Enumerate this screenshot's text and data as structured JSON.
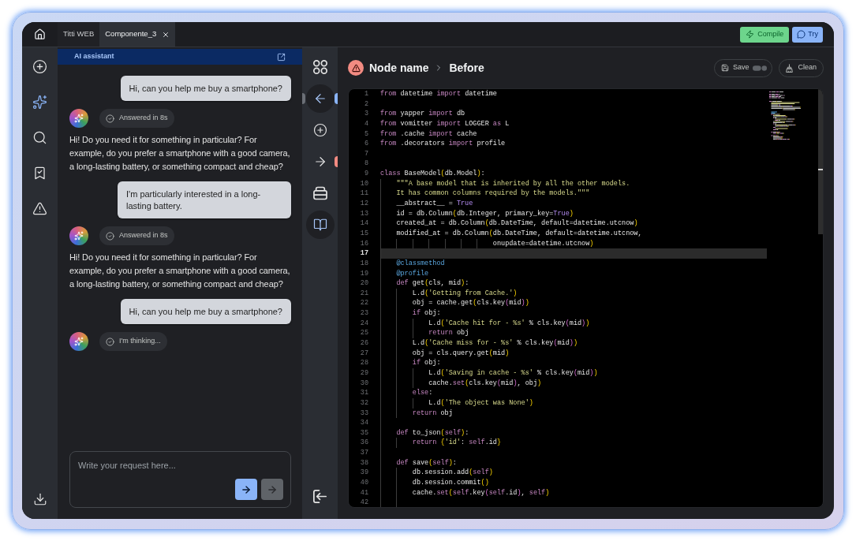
{
  "top_bar": {
    "tabs": [
      {
        "label": "Titti WEB",
        "selected": false,
        "closable": false
      },
      {
        "label": "Componente_3",
        "selected": true,
        "closable": true
      }
    ],
    "actions": [
      {
        "kind": "compile",
        "label": "Compile"
      },
      {
        "kind": "try",
        "label": "Try"
      }
    ]
  },
  "sidebar": {
    "items": [
      {
        "selected": false
      },
      {
        "selected": true
      },
      {
        "selected": false
      },
      {
        "selected": false
      },
      {
        "selected": false
      }
    ],
    "bottom_items": [
      {
        "selected": false
      }
    ]
  },
  "assistant": {
    "title": "AI assistant",
    "messages": [
      {
        "kind": "user",
        "text": "Hi, can you help me buy a smartphone?"
      },
      {
        "kind": "assistant",
        "status": "Answered in 8s",
        "text": "Hi! Do you need it for something in particular? For example, do you prefer a smartphone with a good camera, a long-lasting battery, or something compact and cheap?"
      },
      {
        "kind": "user",
        "text": "I'm particularly interested in a long-lasting battery."
      },
      {
        "kind": "assistant",
        "status": "Answered in 8s",
        "text": "Hi! Do you need it for something in particular? For example, do you prefer a smartphone with a good camera, a long-lasting battery, or something compact and cheap?"
      },
      {
        "kind": "user",
        "text": "Hi, can you help me buy a smartphone?"
      },
      {
        "kind": "assistant",
        "status": "I'm thinking..."
      }
    ],
    "input": {
      "placeholder": "Write your request here..."
    },
    "send_buttons": [
      {
        "disabled": false
      },
      {
        "disabled": true
      }
    ]
  },
  "toolbar": {
    "items": [
      {
        "selected": false
      },
      {
        "selected": true,
        "ports": [
          {
            "kind": "left",
            "color": "#6b6f76"
          },
          {
            "kind": "right",
            "color": "#8ab4f8"
          }
        ]
      },
      {
        "selected": false
      },
      {
        "selected": false,
        "ports": [
          {
            "kind": "right",
            "color": "#f28b82"
          }
        ]
      },
      {
        "selected": false
      },
      {
        "selected": true
      }
    ],
    "bottom_items": [
      {
        "selected": false
      }
    ]
  },
  "editor": {
    "error": true,
    "breadcrumb": [
      "Node name",
      "Before"
    ],
    "actions": [
      {
        "kind": "save",
        "label": "Save"
      },
      {
        "kind": "clean",
        "label": "Clean"
      }
    ],
    "lines": [
      {
        "number": "1",
        "highlighted": false,
        "tokens": [
          {
            "text": "from",
            "kind": "keyword"
          },
          {
            "text": " datetime ",
            "kind": "plain"
          },
          {
            "text": "import",
            "kind": "keyword"
          },
          {
            "text": " datetime",
            "kind": "plain"
          }
        ]
      },
      {
        "number": "2",
        "highlighted": false
      },
      {
        "number": "3",
        "highlighted": false,
        "tokens": [
          {
            "text": "from",
            "kind": "keyword"
          },
          {
            "text": " yapper ",
            "kind": "plain"
          },
          {
            "text": "import",
            "kind": "keyword"
          },
          {
            "text": " db",
            "kind": "plain"
          }
        ]
      },
      {
        "number": "4",
        "highlighted": false,
        "tokens": [
          {
            "text": "from",
            "kind": "keyword"
          },
          {
            "text": " vomitter ",
            "kind": "plain"
          },
          {
            "text": "import",
            "kind": "keyword"
          },
          {
            "text": " LOGGER ",
            "kind": "plain"
          },
          {
            "text": "as",
            "kind": "keyword"
          },
          {
            "text": " L",
            "kind": "plain"
          }
        ]
      },
      {
        "number": "5",
        "highlighted": false,
        "tokens": [
          {
            "text": "from",
            "kind": "keyword"
          },
          {
            "text": " .cache ",
            "kind": "plain"
          },
          {
            "text": "import",
            "kind": "keyword"
          },
          {
            "text": " cache",
            "kind": "plain"
          }
        ]
      },
      {
        "number": "6",
        "highlighted": false,
        "tokens": [
          {
            "text": "from",
            "kind": "keyword"
          },
          {
            "text": " .decorators ",
            "kind": "plain"
          },
          {
            "text": "import",
            "kind": "keyword"
          },
          {
            "text": " profile",
            "kind": "plain"
          }
        ]
      },
      {
        "number": "7",
        "highlighted": false
      },
      {
        "number": "8",
        "highlighted": false
      },
      {
        "number": "9",
        "highlighted": false,
        "tokens": [
          {
            "text": "class",
            "kind": "keyword"
          },
          {
            "text": " BaseModel",
            "kind": "plain"
          },
          {
            "text": "(",
            "kind": "bracket"
          },
          {
            "text": "db.Model",
            "kind": "plain"
          },
          {
            "text": ")",
            "kind": "bracket"
          },
          {
            "text": ":",
            "kind": "plain"
          }
        ]
      },
      {
        "number": "10",
        "highlighted": false,
        "tokens": [
          {
            "text": "    \"\"\"A base model that is inherited by all the other models.",
            "kind": "string"
          }
        ]
      },
      {
        "number": "11",
        "highlighted": false,
        "tokens": [
          {
            "text": "    It has common columns required by the models.\"\"\"",
            "kind": "string"
          }
        ]
      },
      {
        "number": "12",
        "highlighted": false,
        "tokens": [
          {
            "text": "    __abstract__ = ",
            "kind": "plain"
          },
          {
            "text": "True",
            "kind": "constant"
          }
        ]
      },
      {
        "number": "13",
        "highlighted": false,
        "tokens": [
          {
            "text": "    id = db.Column",
            "kind": "plain"
          },
          {
            "text": "(",
            "kind": "bracket"
          },
          {
            "text": "db.Integer, primary_key=",
            "kind": "plain"
          },
          {
            "text": "True",
            "kind": "constant"
          },
          {
            "text": ")",
            "kind": "bracket"
          }
        ]
      },
      {
        "number": "14",
        "highlighted": false,
        "tokens": [
          {
            "text": "    created_at = db.Column",
            "kind": "plain"
          },
          {
            "text": "(",
            "kind": "bracket"
          },
          {
            "text": "db.DateTime, default=datetime.utcnow",
            "kind": "plain"
          },
          {
            "text": ")",
            "kind": "bracket"
          }
        ]
      },
      {
        "number": "15",
        "highlighted": false,
        "tokens": [
          {
            "text": "    modified_at = db.Column",
            "kind": "plain"
          },
          {
            "text": "(",
            "kind": "bracket"
          },
          {
            "text": "db.DateTime, default=datetime.utcnow,",
            "kind": "plain"
          }
        ]
      },
      {
        "number": "16",
        "highlighted": false,
        "tokens": [
          {
            "text": "                            onupdate=datetime.utcnow",
            "kind": "plain"
          },
          {
            "text": ")",
            "kind": "bracket"
          }
        ]
      },
      {
        "number": "17",
        "highlighted": true
      },
      {
        "number": "18",
        "highlighted": false,
        "tokens": [
          {
            "text": "    @classmethod",
            "kind": "decorator"
          }
        ]
      },
      {
        "number": "19",
        "highlighted": false,
        "tokens": [
          {
            "text": "    @profile",
            "kind": "decorator"
          }
        ]
      },
      {
        "number": "20",
        "highlighted": false,
        "tokens": [
          {
            "text": "    def",
            "kind": "keyword"
          },
          {
            "text": " get",
            "kind": "plain"
          },
          {
            "text": "(",
            "kind": "bracket"
          },
          {
            "text": "cls, mid",
            "kind": "plain"
          },
          {
            "text": ")",
            "kind": "bracket"
          },
          {
            "text": ":",
            "kind": "plain"
          }
        ]
      },
      {
        "number": "21",
        "highlighted": false,
        "tokens": [
          {
            "text": "        L.d",
            "kind": "plain"
          },
          {
            "text": "(",
            "kind": "bracket"
          },
          {
            "text": "'Getting from Cache.'",
            "kind": "string"
          },
          {
            "text": ")",
            "kind": "bracket"
          }
        ]
      },
      {
        "number": "22",
        "highlighted": false,
        "tokens": [
          {
            "text": "        obj = cache.get",
            "kind": "plain"
          },
          {
            "text": "(",
            "kind": "bracket"
          },
          {
            "text": "cls.key",
            "kind": "plain"
          },
          {
            "text": "(",
            "kind": "bracket2"
          },
          {
            "text": "mid",
            "kind": "plain"
          },
          {
            "text": ")",
            "kind": "bracket2"
          },
          {
            "text": ")",
            "kind": "bracket"
          }
        ]
      },
      {
        "number": "23",
        "highlighted": false,
        "tokens": [
          {
            "text": "        if",
            "kind": "keyword"
          },
          {
            "text": " obj:",
            "kind": "plain"
          }
        ]
      },
      {
        "number": "24",
        "highlighted": false,
        "tokens": [
          {
            "text": "            L.d",
            "kind": "plain"
          },
          {
            "text": "(",
            "kind": "bracket"
          },
          {
            "text": "'Cache hit for - %s'",
            "kind": "string"
          },
          {
            "text": " % cls.key",
            "kind": "plain"
          },
          {
            "text": "(",
            "kind": "bracket2"
          },
          {
            "text": "mid",
            "kind": "plain"
          },
          {
            "text": ")",
            "kind": "bracket2"
          },
          {
            "text": ")",
            "kind": "bracket"
          }
        ]
      },
      {
        "number": "25",
        "highlighted": false,
        "tokens": [
          {
            "text": "            return",
            "kind": "keyword"
          },
          {
            "text": " obj",
            "kind": "plain"
          }
        ]
      },
      {
        "number": "26",
        "highlighted": false,
        "tokens": [
          {
            "text": "        L.d",
            "kind": "plain"
          },
          {
            "text": "(",
            "kind": "bracket"
          },
          {
            "text": "'Cache miss for - %s'",
            "kind": "string"
          },
          {
            "text": " % cls.key",
            "kind": "plain"
          },
          {
            "text": "(",
            "kind": "bracket2"
          },
          {
            "text": "mid",
            "kind": "plain"
          },
          {
            "text": ")",
            "kind": "bracket2"
          },
          {
            "text": ")",
            "kind": "bracket"
          }
        ]
      },
      {
        "number": "27",
        "highlighted": false,
        "tokens": [
          {
            "text": "        obj = cls.query.get",
            "kind": "plain"
          },
          {
            "text": "(",
            "kind": "bracket"
          },
          {
            "text": "mid",
            "kind": "plain"
          },
          {
            "text": ")",
            "kind": "bracket"
          }
        ]
      },
      {
        "number": "28",
        "highlighted": false,
        "tokens": [
          {
            "text": "        if",
            "kind": "keyword"
          },
          {
            "text": " obj:",
            "kind": "plain"
          }
        ]
      },
      {
        "number": "29",
        "highlighted": false,
        "tokens": [
          {
            "text": "            L.d",
            "kind": "plain"
          },
          {
            "text": "(",
            "kind": "bracket"
          },
          {
            "text": "'Saving in cache - %s'",
            "kind": "string"
          },
          {
            "text": " % cls.key",
            "kind": "plain"
          },
          {
            "text": "(",
            "kind": "bracket2"
          },
          {
            "text": "mid",
            "kind": "plain"
          },
          {
            "text": ")",
            "kind": "bracket2"
          },
          {
            "text": ")",
            "kind": "bracket"
          }
        ]
      },
      {
        "number": "30",
        "highlighted": false,
        "tokens": [
          {
            "text": "            cache.",
            "kind": "plain"
          },
          {
            "text": "set",
            "kind": "keyword"
          },
          {
            "text": "(",
            "kind": "bracket"
          },
          {
            "text": "cls.key",
            "kind": "plain"
          },
          {
            "text": "(",
            "kind": "bracket2"
          },
          {
            "text": "mid",
            "kind": "plain"
          },
          {
            "text": ")",
            "kind": "bracket2"
          },
          {
            "text": ", obj",
            "kind": "plain"
          },
          {
            "text": ")",
            "kind": "bracket"
          }
        ]
      },
      {
        "number": "31",
        "highlighted": false,
        "tokens": [
          {
            "text": "        else",
            "kind": "keyword"
          },
          {
            "text": ":",
            "kind": "plain"
          }
        ]
      },
      {
        "number": "32",
        "highlighted": false,
        "tokens": [
          {
            "text": "            L.d",
            "kind": "plain"
          },
          {
            "text": "(",
            "kind": "bracket"
          },
          {
            "text": "'The object was None'",
            "kind": "string"
          },
          {
            "text": ")",
            "kind": "bracket"
          }
        ]
      },
      {
        "number": "33",
        "highlighted": false,
        "tokens": [
          {
            "text": "        return",
            "kind": "keyword"
          },
          {
            "text": " obj",
            "kind": "plain"
          }
        ]
      },
      {
        "number": "34",
        "highlighted": false
      },
      {
        "number": "35",
        "highlighted": false,
        "tokens": [
          {
            "text": "    def",
            "kind": "keyword"
          },
          {
            "text": " to_json",
            "kind": "plain"
          },
          {
            "text": "(",
            "kind": "bracket"
          },
          {
            "text": "self",
            "kind": "keyword"
          },
          {
            "text": ")",
            "kind": "bracket"
          },
          {
            "text": ":",
            "kind": "plain"
          }
        ]
      },
      {
        "number": "36",
        "highlighted": false,
        "tokens": [
          {
            "text": "        return",
            "kind": "keyword"
          },
          {
            "text": " {",
            "kind": "bracket"
          },
          {
            "text": "'id'",
            "kind": "string"
          },
          {
            "text": ": ",
            "kind": "plain"
          },
          {
            "text": "self",
            "kind": "keyword"
          },
          {
            "text": ".id",
            "kind": "plain"
          },
          {
            "text": "}",
            "kind": "bracket"
          }
        ]
      },
      {
        "number": "37",
        "highlighted": false
      },
      {
        "number": "38",
        "highlighted": false,
        "tokens": [
          {
            "text": "    def",
            "kind": "keyword"
          },
          {
            "text": " save",
            "kind": "plain"
          },
          {
            "text": "(",
            "kind": "bracket"
          },
          {
            "text": "self",
            "kind": "keyword"
          },
          {
            "text": ")",
            "kind": "bracket"
          },
          {
            "text": ":",
            "kind": "plain"
          }
        ]
      },
      {
        "number": "39",
        "highlighted": false,
        "tokens": [
          {
            "text": "        db.session.add",
            "kind": "plain"
          },
          {
            "text": "(",
            "kind": "bracket"
          },
          {
            "text": "self",
            "kind": "keyword"
          },
          {
            "text": ")",
            "kind": "bracket"
          }
        ]
      },
      {
        "number": "40",
        "highlighted": false,
        "tokens": [
          {
            "text": "        db.session.commit",
            "kind": "plain"
          },
          {
            "text": "()",
            "kind": "bracket"
          }
        ]
      },
      {
        "number": "41",
        "highlighted": false,
        "tokens": [
          {
            "text": "        cache.",
            "kind": "plain"
          },
          {
            "text": "set",
            "kind": "keyword"
          },
          {
            "text": "(",
            "kind": "bracket"
          },
          {
            "text": "self",
            "kind": "keyword"
          },
          {
            "text": ".key",
            "kind": "plain"
          },
          {
            "text": "(",
            "kind": "bracket2"
          },
          {
            "text": "self",
            "kind": "keyword"
          },
          {
            "text": ".id",
            "kind": "plain"
          },
          {
            "text": ")",
            "kind": "bracket2"
          },
          {
            "text": ", ",
            "kind": "plain"
          },
          {
            "text": "self",
            "kind": "keyword"
          },
          {
            "text": ")",
            "kind": "bracket"
          }
        ]
      },
      {
        "number": "42",
        "highlighted": false
      }
    ]
  }
}
